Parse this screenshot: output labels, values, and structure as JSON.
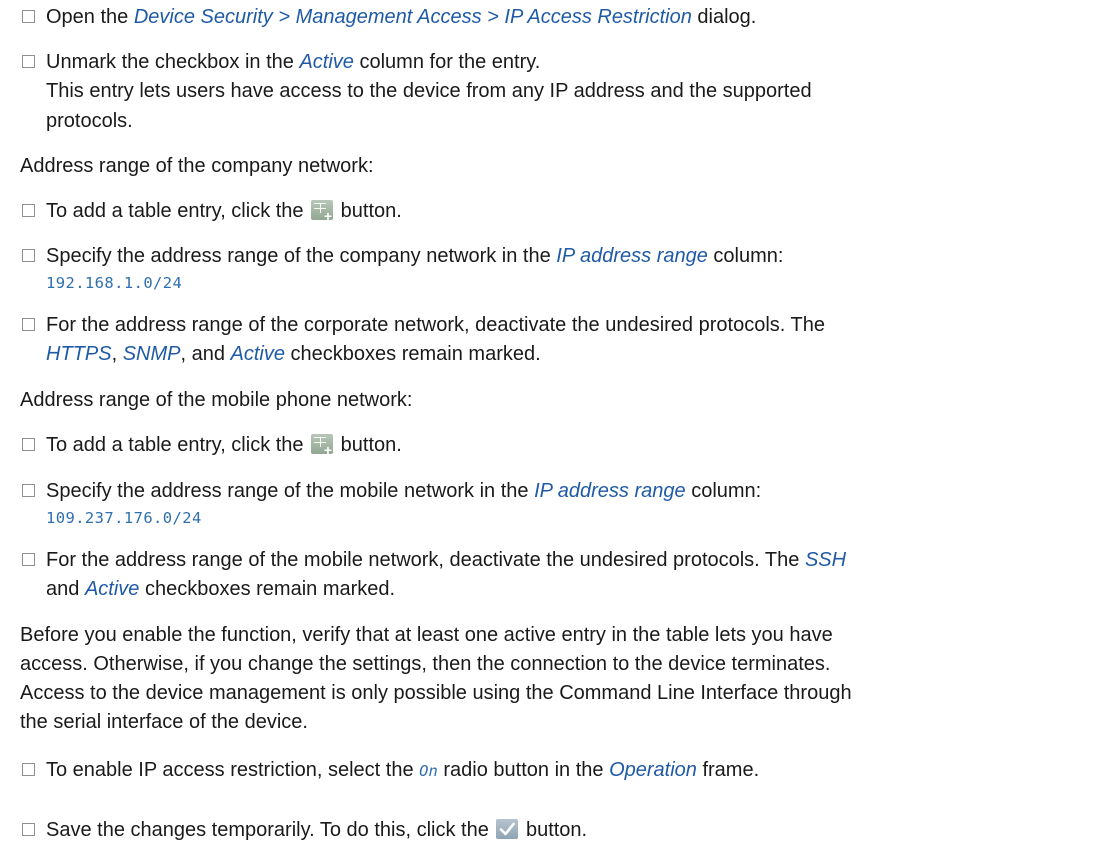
{
  "steps": {
    "s1": {
      "pre": "Open the ",
      "em": "Device Security > Management Access > IP Access Restriction",
      "post": " dialog."
    },
    "s2": {
      "pre": "Unmark the checkbox in the ",
      "em": "Active",
      "post": " column for the entry.",
      "line2": "This entry lets users have access to the device from any IP address and the supported",
      "line3": "protocols."
    },
    "company_heading": "Address range of the company network:",
    "s3": {
      "pre": "To add a table entry, click the ",
      "post": " button."
    },
    "s4": {
      "pre": "Specify the address range of the company network in the ",
      "em": "IP address range",
      "post": " column:",
      "code": "192.168.1.0/24"
    },
    "s5": {
      "line1": "For the address range of the corporate network, deactivate the undesired protocols. The",
      "em1": "HTTPS",
      "sep1": ", ",
      "em2": "SNMP",
      "sep2": ", and ",
      "em3": "Active",
      "post": " checkboxes remain marked."
    },
    "mobile_heading": "Address range of the mobile phone network:",
    "s6": {
      "pre": "To add a table entry, click the ",
      "post": " button."
    },
    "s7": {
      "pre": "Specify the address range of the mobile network in the ",
      "em": "IP address range",
      "post": " column:",
      "code": "109.237.176.0/24"
    },
    "s8": {
      "pre": "For the address range of the mobile network, deactivate the undesired protocols. The ",
      "em1": "SSH",
      "sep": "and ",
      "em2": "Active",
      "post": " checkboxes remain marked."
    },
    "warning": {
      "line1": "Before you enable the function, verify that at least one active entry in the table lets you have",
      "line2": "access. Otherwise, if you change the settings, then the connection to the device terminates.",
      "line3": "Access to the device management is only possible using the Command Line Interface through",
      "line4": "the serial interface of the device."
    },
    "s9": {
      "pre": "To enable IP access restriction, select the ",
      "mono": "On",
      "mid": " radio button in the ",
      "em": "Operation",
      "post": " frame."
    },
    "s10": {
      "pre": "Save the changes temporarily. To do this, click the ",
      "post": " button."
    },
    "icons": {
      "add": "add-table-entry-icon",
      "save": "checkmark-save-icon"
    }
  }
}
